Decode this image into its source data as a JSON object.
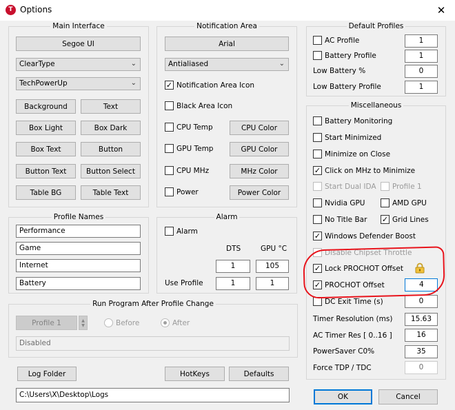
{
  "window": {
    "title": "Options",
    "app_icon": "T",
    "close_glyph": "✕"
  },
  "main_interface": {
    "title": "Main Interface",
    "font_button": "Segoe UI",
    "rendering_select": "ClearType",
    "theme_select": "TechPowerUp",
    "color_buttons": [
      "Background",
      "Text",
      "Box Light",
      "Box Dark",
      "Box Text",
      "Button",
      "Button Text",
      "Button Select",
      "Table BG",
      "Table Text"
    ]
  },
  "notification_area": {
    "title": "Notification Area",
    "font_button": "Arial",
    "rendering_select": "Antialiased",
    "icon_checkbox": {
      "label": "Notification Area Icon",
      "checked": true
    },
    "black_checkbox": {
      "label": "Black Area Icon",
      "checked": false
    },
    "rows": [
      {
        "label": "CPU Temp",
        "button": "CPU Color"
      },
      {
        "label": "GPU Temp",
        "button": "GPU Color"
      },
      {
        "label": "CPU MHz",
        "button": "MHz Color"
      },
      {
        "label": "Power",
        "button": "Power Color"
      }
    ]
  },
  "profile_names": {
    "title": "Profile Names",
    "values": [
      "Performance",
      "Game",
      "Internet",
      "Battery"
    ]
  },
  "alarm": {
    "title": "Alarm",
    "checkbox": "Alarm",
    "col_dts": "DTS",
    "col_gpu": "GPU °C",
    "dts": "1",
    "gpu": "105",
    "use_profile_label": "Use Profile",
    "use_dts": "1",
    "use_gpu": "1"
  },
  "run_program": {
    "title": "Run Program After Profile Change",
    "profile_button": "Profile 1",
    "before": "Before",
    "after": "After",
    "path": "Disabled"
  },
  "buttons": {
    "log_folder": "Log Folder",
    "hotkeys": "HotKeys",
    "defaults": "Defaults",
    "ok": "OK",
    "cancel": "Cancel"
  },
  "log_path": "C:\\Users\\X\\Desktop\\Logs",
  "default_profiles": {
    "title": "Default Profiles",
    "rows": [
      {
        "label": "AC Profile",
        "value": "1",
        "checkbox": true
      },
      {
        "label": "Battery Profile",
        "value": "1",
        "checkbox": true
      },
      {
        "label": "Low Battery %",
        "value": "0",
        "checkbox": false
      },
      {
        "label": "Low Battery Profile",
        "value": "1",
        "checkbox": false
      }
    ]
  },
  "misc": {
    "title": "Miscellaneous",
    "battery_monitoring": "Battery Monitoring",
    "start_minimized": "Start Minimized",
    "minimize_on_close": "Minimize on Close",
    "click_mhz": "Click on MHz to Minimize",
    "start_dual_ida": "Start Dual IDA",
    "profile_1": "Profile 1",
    "nvidia_gpu": "Nvidia GPU",
    "amd_gpu": "AMD GPU",
    "no_title_bar": "No Title Bar",
    "grid_lines": "Grid Lines",
    "windows_defender_boost": "Windows Defender Boost",
    "disable_chipset_throttle": "Disable Chipset Throttle",
    "lock_prochot": "Lock PROCHOT Offset",
    "prochot_offset": "PROCHOT Offset",
    "prochot_value": "4",
    "dc_exit_time": "DC Exit Time (s)",
    "dc_exit_value": "0",
    "timer_resolution": "Timer Resolution (ms)",
    "timer_resolution_value": "15.63",
    "ac_timer_res": "AC Timer Res [ 0..16 ]",
    "ac_timer_res_value": "16",
    "powersaver": "PowerSaver C0%",
    "powersaver_value": "35",
    "force_tdp": "Force TDP / TDC",
    "force_tdp_value": "0"
  },
  "colors": {
    "accent": "#0078d7",
    "annotation": "#e8141c",
    "app_icon": "#c8102e"
  }
}
